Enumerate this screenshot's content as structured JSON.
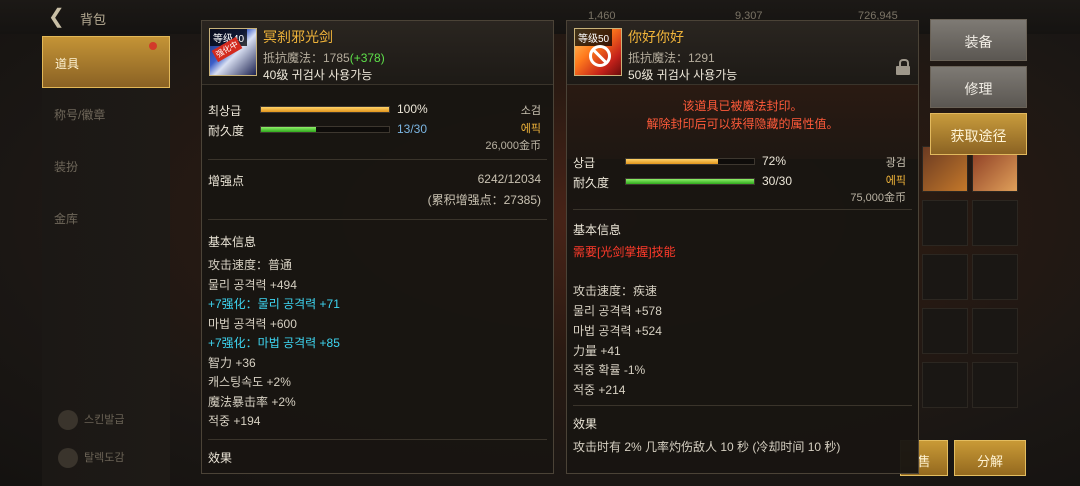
{
  "topbar": {
    "title": "背包",
    "currencies": [
      "1,460",
      "9,307",
      "726,945"
    ]
  },
  "sidebar": {
    "items": [
      {
        "label": "道具"
      },
      {
        "label": "称号/徽章"
      },
      {
        "label": "装扮"
      },
      {
        "label": "金库"
      }
    ],
    "footer": [
      "스킨발급",
      "탈렉도감"
    ]
  },
  "bottom_buttons": [
    "售",
    "分解"
  ],
  "item1": {
    "level_badge": "等级40",
    "tag": "强化中",
    "name": "冥刹邪光剑",
    "resist_label": "抵抗魔法：1785",
    "resist_bonus": "(+378)",
    "requirement": "40级 귀검사 사용가능",
    "grade_label": "최상급",
    "grade_value": "100%",
    "grade_fraction": 1.0,
    "durability_label": "耐久度",
    "durability_value": "13/30",
    "durability_fraction": 0.4333,
    "type": "소검",
    "rarity": "에픽",
    "price": "26,000金币",
    "enhance_label": "增强点",
    "enhance_value": "6242/12034",
    "enhance_total": "(累积增强点：27385)",
    "info_title": "基本信息",
    "stats": [
      {
        "text": "攻击速度：普通",
        "style": "white"
      },
      {
        "text": "물리 공격력 +494",
        "style": "white"
      },
      {
        "text": "+7强化：물리 공격력 +71",
        "style": "cyan"
      },
      {
        "text": "마법 공격력 +600",
        "style": "white"
      },
      {
        "text": "+7强化：마법 공격력 +85",
        "style": "cyan"
      },
      {
        "text": "智力 +36",
        "style": "white"
      },
      {
        "text": "캐스팅속도 +2%",
        "style": "white"
      },
      {
        "text": "魔法暴击率 +2%",
        "style": "white"
      },
      {
        "text": "적중 +194",
        "style": "white"
      }
    ],
    "effect_title": "效果"
  },
  "item2": {
    "level_badge": "等级50",
    "name": "你好你好",
    "resist_label": "抵抗魔法：1291",
    "requirement": "50级 귀검사 사용가능",
    "seal_line1": "该道具已被魔法封印。",
    "seal_line2": "解除封印后可以获得隐藏的属性值。",
    "grade_label": "상급",
    "grade_value": "72%",
    "grade_fraction": 0.72,
    "durability_label": "耐久度",
    "durability_value": "30/30",
    "durability_fraction": 1.0,
    "type": "광검",
    "rarity": "에픽",
    "price": "75,000金币",
    "info_title": "基本信息",
    "skill_req": "需要[光剑掌握]技能",
    "stats": [
      {
        "text": "攻击速度：疾速"
      },
      {
        "text": "물리 공격력 +578"
      },
      {
        "text": "마법 공격력 +524"
      },
      {
        "text": "力量 +41"
      },
      {
        "text": "적중 확률 -1%"
      },
      {
        "text": "적중 +214"
      }
    ],
    "effect_title": "效果",
    "effect_text": "攻击时有 2% 几率灼伤敌人 10 秒 (冷却时间 10 秒)"
  },
  "actions": {
    "equip": "装备",
    "repair": "修理",
    "obtain": "获取途径"
  },
  "colors": {
    "gold_text": "#f0b43a",
    "green_bonus": "#5ee04a",
    "cyan_enhance": "#3ed6f2",
    "red_warning": "#ff3a2a"
  }
}
